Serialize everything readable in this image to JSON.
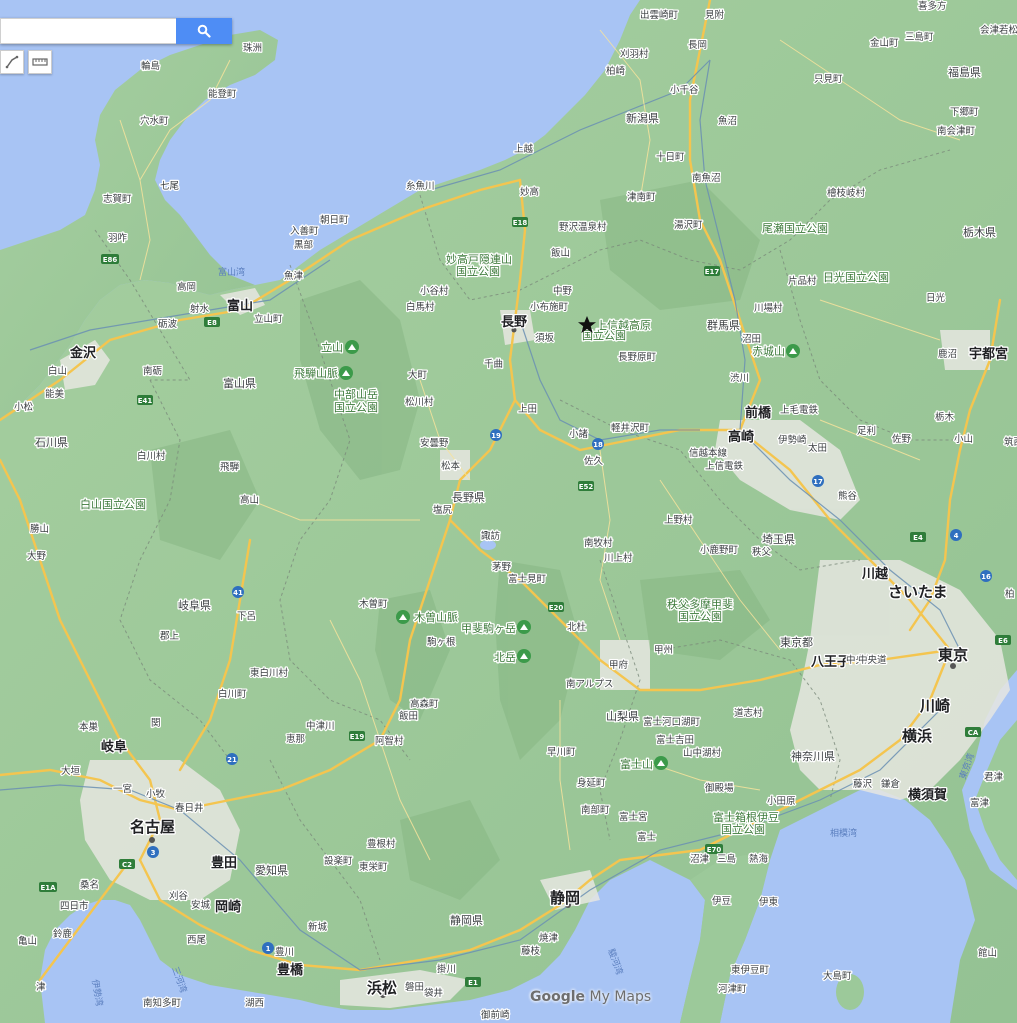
{
  "search": {
    "value": "",
    "placeholder": ""
  },
  "toolbar": {
    "search_icon": "search-icon",
    "draw_icon": "draw-line-icon",
    "ruler_icon": "ruler-icon"
  },
  "watermark": {
    "brand": "Google",
    "product": "My Maps"
  },
  "colors": {
    "water": "#a8c4f4",
    "land": "#9cc99a",
    "urban": "#e6e6e0",
    "road_major": "#f4c54f",
    "road_minor": "#ffffff",
    "rail": "#6a8fb3",
    "search": "#4e8df5"
  },
  "marker": {
    "name": "star-marker",
    "label": "上信越高原国立公園"
  },
  "labels": {
    "major_cities": [
      {
        "name": "長野"
      },
      {
        "name": "名古屋"
      },
      {
        "name": "さいたま"
      },
      {
        "name": "東京"
      },
      {
        "name": "川崎"
      },
      {
        "name": "横浜"
      },
      {
        "name": "静岡"
      },
      {
        "name": "浜松"
      }
    ],
    "cities": [
      {
        "name": "富山"
      },
      {
        "name": "金沢"
      },
      {
        "name": "前橋"
      },
      {
        "name": "高崎"
      },
      {
        "name": "宇都宮"
      },
      {
        "name": "岐阜"
      },
      {
        "name": "豊田"
      },
      {
        "name": "岡崎"
      },
      {
        "name": "豊橋"
      },
      {
        "name": "八王子"
      },
      {
        "name": "横須賀"
      },
      {
        "name": "川越"
      }
    ],
    "prefectures": [
      {
        "name": "新潟県"
      },
      {
        "name": "福島県"
      },
      {
        "name": "栃木県"
      },
      {
        "name": "群馬県"
      },
      {
        "name": "富山県"
      },
      {
        "name": "石川県"
      },
      {
        "name": "長野県"
      },
      {
        "name": "岐阜県"
      },
      {
        "name": "埼玉県"
      },
      {
        "name": "東京都"
      },
      {
        "name": "山梨県"
      },
      {
        "name": "神奈川県"
      },
      {
        "name": "愛知県"
      },
      {
        "name": "静岡県"
      }
    ],
    "parks": [
      {
        "name": "妙高戸隠連山"
      },
      {
        "name": "国立公園"
      },
      {
        "name": "上信越高原"
      },
      {
        "name": "国立公園"
      },
      {
        "name": "尾瀬国立公園"
      },
      {
        "name": "日光国立公園"
      },
      {
        "name": "中部山岳"
      },
      {
        "name": "国立公園"
      },
      {
        "name": "白山国立公園"
      },
      {
        "name": "秩父多摩甲斐"
      },
      {
        "name": "国立公園"
      },
      {
        "name": "富士箱根伊豆"
      },
      {
        "name": "国立公園"
      }
    ],
    "mountains": [
      {
        "name": "立山"
      },
      {
        "name": "飛騨山脈"
      },
      {
        "name": "赤城山"
      },
      {
        "name": "木曽山脈"
      },
      {
        "name": "甲斐駒ヶ岳"
      },
      {
        "name": "北岳"
      },
      {
        "name": "富士山"
      }
    ],
    "towns": [
      {
        "name": "出雲崎町"
      },
      {
        "name": "見附"
      },
      {
        "name": "喜多方"
      },
      {
        "name": "三島町"
      },
      {
        "name": "会津若松"
      },
      {
        "name": "長岡"
      },
      {
        "name": "金山町"
      },
      {
        "name": "刈羽村"
      },
      {
        "name": "柏崎"
      },
      {
        "name": "小千谷"
      },
      {
        "name": "只見町"
      },
      {
        "name": "下郷町"
      },
      {
        "name": "魚沼"
      },
      {
        "name": "南会津町"
      },
      {
        "name": "十日町"
      },
      {
        "name": "上越"
      },
      {
        "name": "南魚沼"
      },
      {
        "name": "妙高"
      },
      {
        "name": "糸魚川"
      },
      {
        "name": "津南町"
      },
      {
        "name": "檜枝岐村"
      },
      {
        "name": "朝日町"
      },
      {
        "name": "入善町"
      },
      {
        "name": "黒部"
      },
      {
        "name": "野沢温泉村"
      },
      {
        "name": "湯沢町"
      },
      {
        "name": "飯山"
      },
      {
        "name": "魚津"
      },
      {
        "name": "片品村"
      },
      {
        "name": "小谷村"
      },
      {
        "name": "中野"
      },
      {
        "name": "白馬村"
      },
      {
        "name": "小布施町"
      },
      {
        "name": "川場村"
      },
      {
        "name": "日光"
      },
      {
        "name": "須坂"
      },
      {
        "name": "沼田"
      },
      {
        "name": "長野原町"
      },
      {
        "name": "千曲"
      },
      {
        "name": "大町"
      },
      {
        "name": "鹿沼"
      },
      {
        "name": "渋川"
      },
      {
        "name": "松川村"
      },
      {
        "name": "上毛電鉄"
      },
      {
        "name": "上田"
      },
      {
        "name": "栃木"
      },
      {
        "name": "軽井沢町"
      },
      {
        "name": "小諸"
      },
      {
        "name": "小山"
      },
      {
        "name": "足利"
      },
      {
        "name": "佐野"
      },
      {
        "name": "安曇野"
      },
      {
        "name": "伊勢崎"
      },
      {
        "name": "太田"
      },
      {
        "name": "信越本線"
      },
      {
        "name": "佐久"
      },
      {
        "name": "上信電鉄"
      },
      {
        "name": "松本"
      },
      {
        "name": "熊谷"
      },
      {
        "name": "筑西"
      },
      {
        "name": "塩尻"
      },
      {
        "name": "上野村"
      },
      {
        "name": "諏訪"
      },
      {
        "name": "南牧村"
      },
      {
        "name": "小鹿野町"
      },
      {
        "name": "秩父"
      },
      {
        "name": "川上村"
      },
      {
        "name": "茅野"
      },
      {
        "name": "富士見町"
      },
      {
        "name": "柏"
      },
      {
        "name": "木曽町"
      },
      {
        "name": "北杜"
      },
      {
        "name": "駒ヶ根"
      },
      {
        "name": "甲州"
      },
      {
        "name": "中央線"
      },
      {
        "name": "甲府"
      },
      {
        "name": "南アルプス"
      },
      {
        "name": "高森町"
      },
      {
        "name": "飯田"
      },
      {
        "name": "道志村"
      },
      {
        "name": "富士河口湖町"
      },
      {
        "name": "富士吉田"
      },
      {
        "name": "山中湖村"
      },
      {
        "name": "阿智村"
      },
      {
        "name": "早川町"
      },
      {
        "name": "御殿場"
      },
      {
        "name": "藤沢"
      },
      {
        "name": "鎌倉"
      },
      {
        "name": "小田原"
      },
      {
        "name": "身延町"
      },
      {
        "name": "南部町"
      },
      {
        "name": "富士宮"
      },
      {
        "name": "富士"
      },
      {
        "name": "沼津"
      },
      {
        "name": "三島"
      },
      {
        "name": "熱海"
      },
      {
        "name": "輪島"
      },
      {
        "name": "珠洲"
      },
      {
        "name": "能登町"
      },
      {
        "name": "穴水町"
      },
      {
        "name": "七尾"
      },
      {
        "name": "志賀町"
      },
      {
        "name": "羽咋"
      },
      {
        "name": "高岡"
      },
      {
        "name": "射水"
      },
      {
        "name": "砺波"
      },
      {
        "name": "立山町"
      },
      {
        "name": "白山"
      },
      {
        "name": "能美"
      },
      {
        "name": "小松"
      },
      {
        "name": "南砺"
      },
      {
        "name": "飛騨"
      },
      {
        "name": "白川村"
      },
      {
        "name": "高山"
      },
      {
        "name": "勝山"
      },
      {
        "name": "大野"
      },
      {
        "name": "下呂"
      },
      {
        "name": "郡上"
      },
      {
        "name": "白川町"
      },
      {
        "name": "東白川村"
      },
      {
        "name": "関"
      },
      {
        "name": "本巣"
      },
      {
        "name": "大垣"
      },
      {
        "name": "一宮"
      },
      {
        "name": "小牧"
      },
      {
        "name": "春日井"
      },
      {
        "name": "恵那"
      },
      {
        "name": "中津川"
      },
      {
        "name": "豊根村"
      },
      {
        "name": "設楽町"
      },
      {
        "name": "東栄町"
      },
      {
        "name": "新城"
      },
      {
        "name": "豊川"
      },
      {
        "name": "刈谷"
      },
      {
        "name": "安城"
      },
      {
        "name": "西尾"
      },
      {
        "name": "桑名"
      },
      {
        "name": "四日市"
      },
      {
        "name": "鈴鹿"
      },
      {
        "name": "亀山"
      },
      {
        "name": "津"
      },
      {
        "name": "南知多町"
      },
      {
        "name": "湖西"
      },
      {
        "name": "磐田"
      },
      {
        "name": "袋井"
      },
      {
        "name": "掛川"
      },
      {
        "name": "藤枝"
      },
      {
        "name": "焼津"
      },
      {
        "name": "御前崎"
      },
      {
        "name": "伊豆"
      },
      {
        "name": "伊東"
      },
      {
        "name": "東伊豆町"
      },
      {
        "name": "河津町"
      },
      {
        "name": "大島町"
      },
      {
        "name": "館山"
      },
      {
        "name": "富津"
      },
      {
        "name": "君津"
      },
      {
        "name": "中央道"
      },
      {
        "name": "渋谷"
      },
      {
        "name": "東京湾"
      },
      {
        "name": "相模湾"
      },
      {
        "name": "駿河湾"
      },
      {
        "name": "伊勢湾"
      },
      {
        "name": "三河湾"
      },
      {
        "name": "富山湾"
      },
      {
        "name": "城端線"
      },
      {
        "name": "上越新幹線"
      },
      {
        "name": "八高線"
      }
    ],
    "roads": [
      "E8",
      "E17",
      "E18",
      "E41",
      "E52",
      "E20",
      "E19",
      "E1",
      "E1A",
      "C2",
      "E4",
      "E6",
      "E70",
      "CA",
      "E86",
      "18",
      "17",
      "16",
      "21",
      "19",
      "41",
      "3",
      "1",
      "4"
    ]
  }
}
